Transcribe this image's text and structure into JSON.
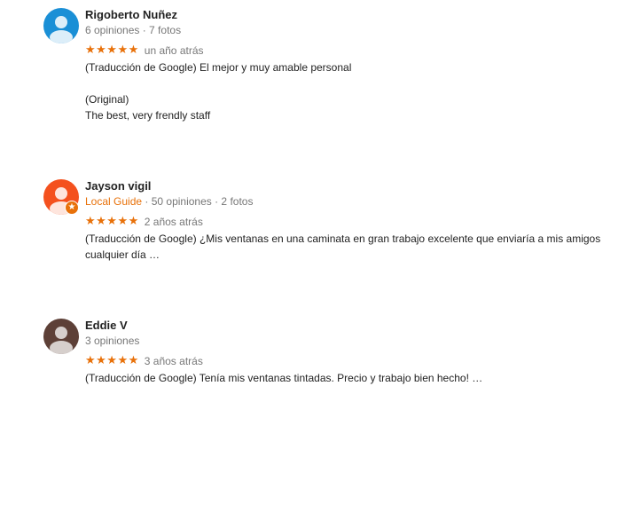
{
  "reviews": [
    {
      "name": "Rigoberto Nuñez",
      "avatar_color": "#1a8fd6",
      "meta": "6 opiniones · 7 fotos",
      "stars": "★★★★★",
      "rating": 5,
      "date": "un año atrás",
      "translated": "(Traducción de Google) El mejor y muy amable personal",
      "original_label": "(Original)",
      "original": "The best, very frendly staff"
    },
    {
      "name": "Jayson vigil",
      "avatar_color": "#f4511e",
      "badge": "★",
      "guide_label": "Local Guide",
      "meta": " · 50 opiniones · 2 fotos",
      "stars": "★★★★★",
      "rating": 5,
      "date": "2 años atrás",
      "translated": "(Traducción de Google) ¿Mis ventanas en una caminata en gran trabajo excelente que enviaría a mis amigos cualquier día …"
    },
    {
      "name": "Eddie V",
      "avatar_color": "#5d4037",
      "meta": "3 opiniones",
      "stars": "★★★★★",
      "rating": 5,
      "date": "3 años atrás",
      "translated": "(Traducción de Google) Tenía mis ventanas tintadas. Precio y trabajo bien hecho! …"
    }
  ],
  "colors": {
    "star": "#e8710a",
    "local_guide": "#e8710a",
    "meta_text": "#777777",
    "body_text": "#222222"
  },
  "icons": {
    "avatar": "person-icon",
    "badge": "local-guide-star-icon",
    "rating": "star-icon"
  }
}
